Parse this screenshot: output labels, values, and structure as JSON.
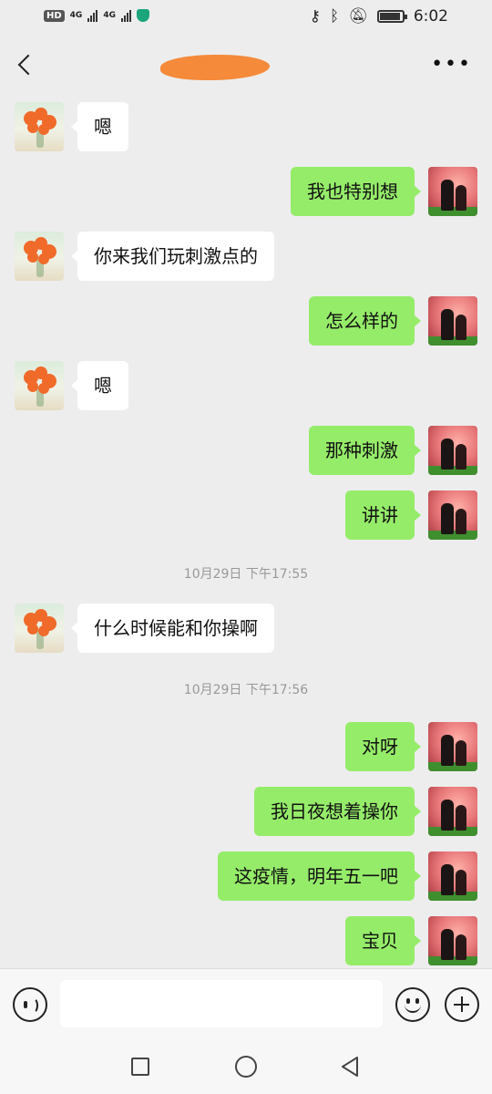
{
  "status_bar": {
    "hd_label": "HD",
    "sim1_label": "4G",
    "sim2_label": "4G",
    "time": "6:02",
    "battery_level": 0.9
  },
  "header": {
    "title": "",
    "more_label": "•••"
  },
  "messages": [
    {
      "side": "left",
      "text": "嗯"
    },
    {
      "side": "right",
      "text": "我也特别想"
    },
    {
      "side": "left",
      "text": "你来我们玩刺激点的"
    },
    {
      "side": "right",
      "text": "怎么样的"
    },
    {
      "side": "left",
      "text": "嗯"
    },
    {
      "side": "right",
      "text": "那种刺激"
    },
    {
      "side": "right",
      "text": "讲讲"
    },
    {
      "type": "time",
      "text": "10月29日 下午17:55"
    },
    {
      "side": "left",
      "text": "什么时候能和你操啊"
    },
    {
      "type": "time",
      "text": "10月29日 下午17:56"
    },
    {
      "side": "right",
      "text": "对呀"
    },
    {
      "side": "right",
      "text": "我日夜想着操你"
    },
    {
      "side": "right",
      "text": "这疫情，明年五一吧"
    },
    {
      "side": "right",
      "text": "宝贝"
    }
  ],
  "input_bar": {
    "value": "",
    "voice_icon": "voice-icon",
    "emoji_icon": "emoji-icon",
    "plus_icon": "plus-icon"
  },
  "colors": {
    "sent_bubble": "#95ec69",
    "received_bubble": "#ffffff",
    "background": "#ededed"
  }
}
